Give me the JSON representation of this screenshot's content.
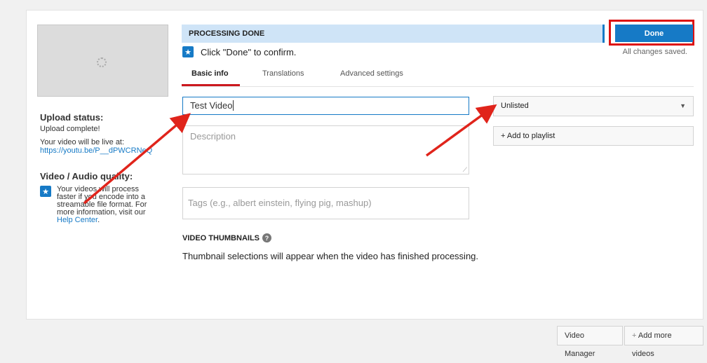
{
  "status_bar": {
    "text": "PROCESSING DONE"
  },
  "actions": {
    "done_label": "Done",
    "saved_text": "All changes saved."
  },
  "confirm": {
    "text": "Click \"Done\" to confirm."
  },
  "tabs": [
    {
      "label": "Basic info",
      "active": true
    },
    {
      "label": "Translations",
      "active": false
    },
    {
      "label": "Advanced settings",
      "active": false
    }
  ],
  "form": {
    "title_value": "Test Video",
    "description_placeholder": "Description",
    "tags_placeholder": "Tags (e.g., albert einstein, flying pig, mashup)"
  },
  "privacy": {
    "selected": "Unlisted",
    "add_playlist": "+ Add to playlist"
  },
  "thumbnails": {
    "heading": "VIDEO THUMBNAILS",
    "note": "Thumbnail selections will appear when the video has finished processing."
  },
  "sidebar": {
    "upload_status_heading": "Upload status:",
    "upload_complete": "Upload complete!",
    "live_at": "Your video will be live at:",
    "url": "https://youtu.be/P__dPWCRNeQ",
    "quality_heading": "Video / Audio quality:",
    "quality_text": "Your videos will process faster if you encode into a streamable file format. For more information, visit our",
    "help_center": "Help Center",
    "help_suffix": "."
  },
  "footer": {
    "video_manager": "Video Manager",
    "add_more": "Add more videos"
  },
  "colors": {
    "accent": "#167ac6",
    "annotation_red": "#e0241b",
    "tab_underline": "#cc181e"
  }
}
